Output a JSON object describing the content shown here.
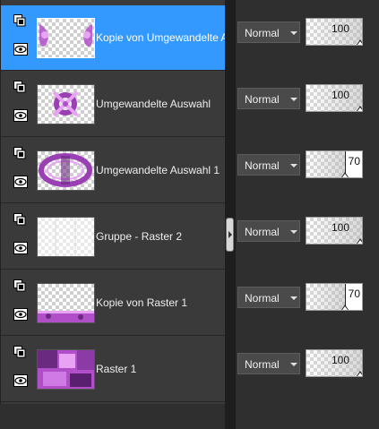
{
  "layers": [
    {
      "name": "Kopie von Umgewandelte Auswahl",
      "blend_mode": "Normal",
      "opacity": "100",
      "opacity_fraction": 1.0,
      "selected": true
    },
    {
      "name": "Umgewandelte Auswahl",
      "blend_mode": "Normal",
      "opacity": "100",
      "opacity_fraction": 1.0,
      "selected": false
    },
    {
      "name": "Umgewandelte Auswahl 1",
      "blend_mode": "Normal",
      "opacity": "70",
      "opacity_fraction": 0.7,
      "selected": false
    },
    {
      "name": "Gruppe - Raster 2",
      "blend_mode": "Normal",
      "opacity": "100",
      "opacity_fraction": 1.0,
      "selected": false
    },
    {
      "name": "Kopie von Raster 1",
      "blend_mode": "Normal",
      "opacity": "70",
      "opacity_fraction": 0.7,
      "selected": false
    },
    {
      "name": "Raster 1",
      "blend_mode": "Normal",
      "opacity": "100",
      "opacity_fraction": 1.0,
      "selected": false
    }
  ],
  "colors": {
    "selection": "#3399ff",
    "panel": "#3a3a3a",
    "accent_purple": "#b04fc8"
  },
  "icons": {
    "group_toggle": "layer-group-icon",
    "visibility": "eye-icon",
    "dropdown": "dropdown-arrow-icon"
  }
}
